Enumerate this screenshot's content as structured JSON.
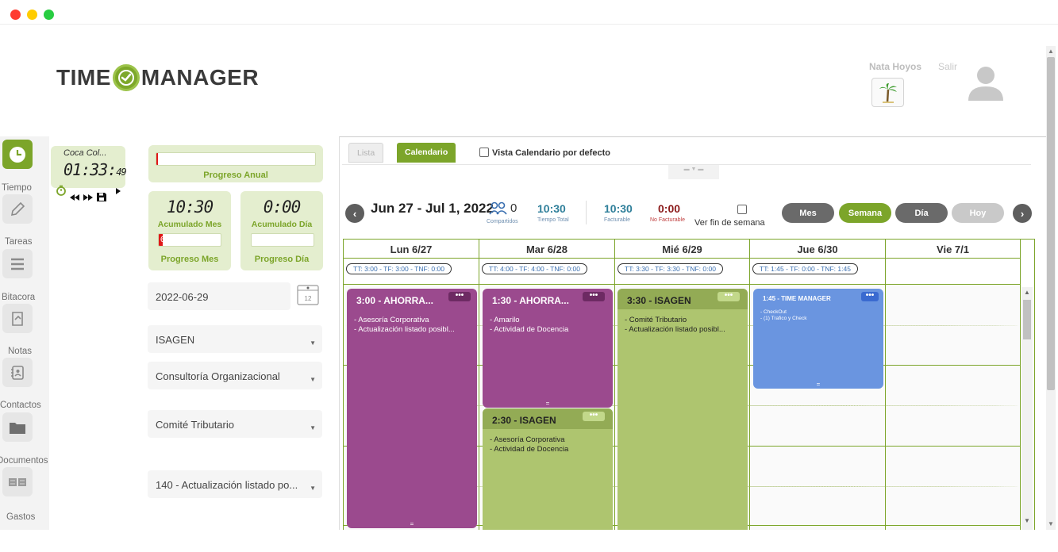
{
  "header": {
    "logo_left": "TIME",
    "logo_right": "MANAGER",
    "user_name": "Nata Hoyos",
    "logout": "Salir"
  },
  "sidebar": {
    "items": [
      {
        "label": "Tiempo",
        "icon": "clock-icon"
      },
      {
        "label": "Tareas",
        "icon": "pencil-icon"
      },
      {
        "label": "Bitacora",
        "icon": "list-icon"
      },
      {
        "label": "Notas",
        "icon": "note-icon"
      },
      {
        "label": "Contactos",
        "icon": "contacts-icon"
      },
      {
        "label": "Documentos",
        "icon": "folder-icon"
      },
      {
        "label": "Gastos",
        "icon": "money-icon"
      }
    ]
  },
  "timer": {
    "client": "Coca Col...",
    "time": "01:33:",
    "seconds": "49"
  },
  "progress": {
    "annual_percent_text": "1%",
    "annual_percent": 1,
    "annual_label": "Progreso Anual",
    "month_value": "10:30",
    "month_label": "Acumulado Mes",
    "day_value": "0:00",
    "day_label": "Acumulado Día",
    "month_percent_text": "6%",
    "month_percent": 6,
    "month_progress_label": "Progreso Mes",
    "day_percent_text": "0%",
    "day_percent": 0,
    "day_progress_label": "Progreso Día"
  },
  "form": {
    "date": "2022-06-29",
    "calendar_day": "12",
    "client": "ISAGEN",
    "service": "Consultoría Organizacional",
    "project": "Comité Tributario",
    "task": "140 - Actualización listado po..."
  },
  "calendar": {
    "tab_list": "Lista",
    "tab_calendar": "Calendario",
    "default_view_label": "Vista Calendario por defecto",
    "range": "Jun 27 - Jul 1, 2022",
    "shared_count": "0",
    "shared_label": "Compartidos",
    "total_time": "10:30",
    "total_time_label": "Tiempo Total",
    "billable": "10:30",
    "billable_label": "Facturable",
    "non_billable": "0:00",
    "non_billable_label": "No Facturable",
    "weekend_label": "Ver fin de semana",
    "btn_month": "Mes",
    "btn_week": "Semana",
    "btn_day": "Día",
    "btn_today": "Hoy",
    "days": [
      {
        "label": "Lun 6/27",
        "tt": "TT: 3:00 - TF: 3:00 - TNF: 0:00"
      },
      {
        "label": "Mar 6/28",
        "tt": "TT: 4:00 - TF: 4:00 - TNF: 0:00"
      },
      {
        "label": "Mié 6/29",
        "tt": "TT: 3:30 - TF: 3:30 - TNF: 0:00"
      },
      {
        "label": "Jue 6/30",
        "tt": "TT: 1:45 - TF: 0:00 - TNF: 1:45"
      },
      {
        "label": "Vie 7/1",
        "tt": ""
      }
    ],
    "events": [
      {
        "title": "3:00 - AHORRA...",
        "lines": [
          "- Asesoría Corporativa",
          "- Actualización listado posibl..."
        ],
        "color": "#9b4a8e"
      },
      {
        "title": "1:30 - AHORRA...",
        "lines": [
          "- Amarilo",
          "- Actividad de Docencia"
        ],
        "color": "#9b4a8e"
      },
      {
        "title": "2:30 - ISAGEN",
        "lines": [
          "- Asesoría Corporativa",
          "- Actividad de Docencia"
        ],
        "color": "#aec56f"
      },
      {
        "title": "3:30 - ISAGEN",
        "lines": [
          "- Comité Tributario",
          "- Actualización listado posibl..."
        ],
        "color": "#aec56f"
      },
      {
        "title": "1:45 - TIME MANAGER",
        "lines": [
          "- CheckOut",
          "- (1) Trafico y Check"
        ],
        "color": "#6a95e0"
      }
    ],
    "event_menu": "•••",
    "grip": "="
  },
  "colors": {
    "accent": "#7ca52a",
    "purple_event": "#9b4a8e",
    "green_event": "#aec56f",
    "blue_event": "#6a95e0"
  }
}
